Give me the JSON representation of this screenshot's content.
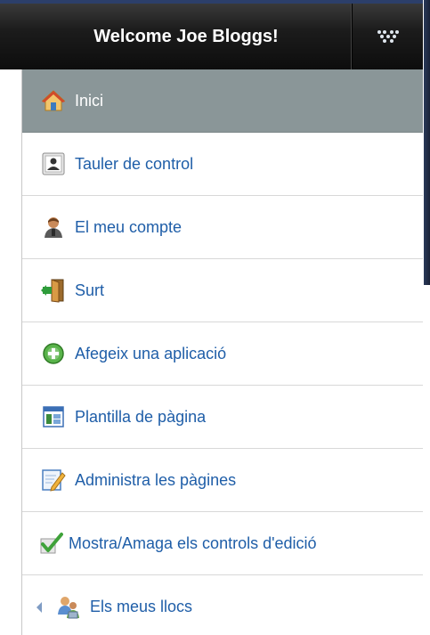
{
  "header": {
    "title": "Welcome Joe Bloggs!",
    "toggle_icon": "dots-diamond-icon"
  },
  "menu": {
    "items": [
      {
        "label": "Inici",
        "icon": "home-icon",
        "active": true
      },
      {
        "label": "Tauler de control",
        "icon": "user-card-icon"
      },
      {
        "label": "El meu compte",
        "icon": "account-user-icon"
      },
      {
        "label": "Surt",
        "icon": "exit-door-icon"
      },
      {
        "label": "Afegeix una aplicació",
        "icon": "add-circle-icon"
      },
      {
        "label": "Plantilla de pàgina",
        "icon": "page-layout-icon"
      },
      {
        "label": "Administra les pàgines",
        "icon": "edit-page-icon"
      },
      {
        "label": "Mostra/Amaga els controls d'edició",
        "icon": "checkmark-icon"
      },
      {
        "label": "Els meus llocs",
        "icon": "my-sites-icon",
        "back_icon": "back-arrow-icon"
      }
    ]
  },
  "colors": {
    "header_bg": "#111111",
    "active_bg": "#8a9698",
    "link": "#1f5ea8"
  }
}
